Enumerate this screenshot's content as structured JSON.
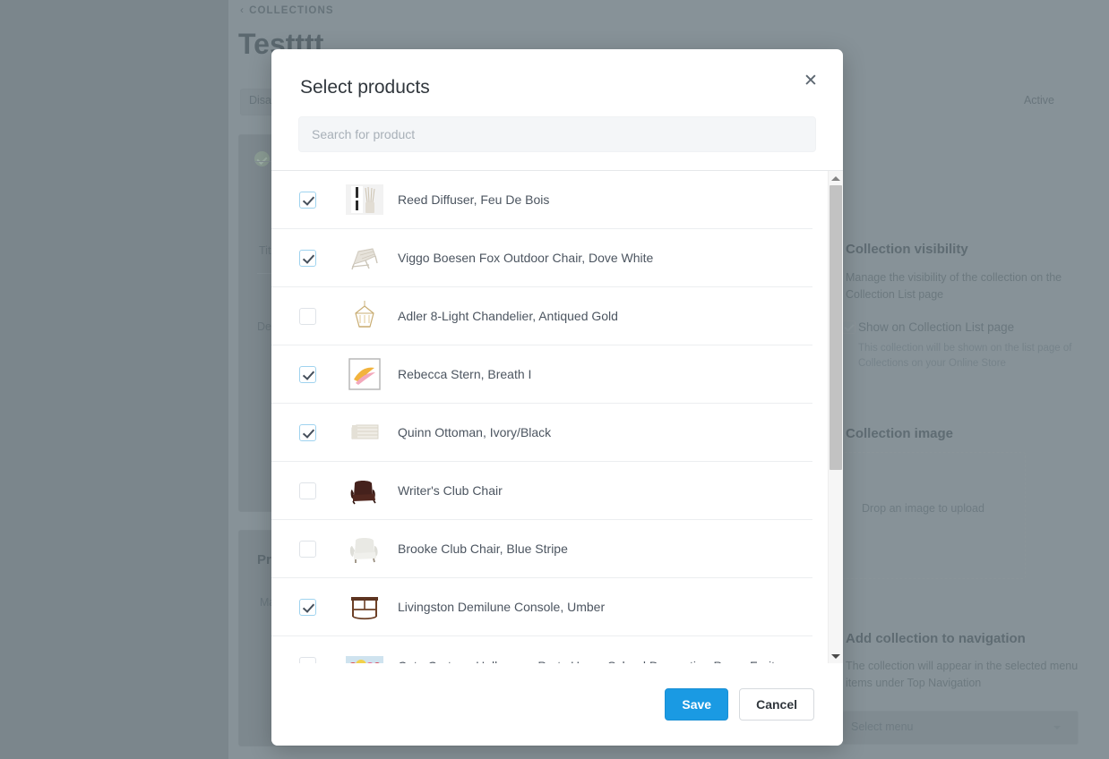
{
  "background": {
    "breadcrumb": "COLLECTIONS",
    "page_title": "Testttt",
    "status_pill": "Disable",
    "status_right": "Active",
    "field_title_label": "Title",
    "field_description_label": "Description",
    "products_section_title": "Products",
    "products_section_sub": "Manage",
    "rail": {
      "visibility_heading": "Collection visibility",
      "visibility_desc": "Manage the visibility of the collection on the Collection List page",
      "visibility_checkbox_label": "Show on Collection List page",
      "visibility_checkbox_sub": "This collection will be shown on the list page of Collections on your Online Store",
      "image_heading": "Collection image",
      "image_dropzone": "Drop an image to upload",
      "navigation_heading": "Add collection to navigation",
      "navigation_desc": "The collection will appear in the selected menu items under Top Navigation",
      "menu_select_value": "Select menu"
    }
  },
  "modal": {
    "title": "Select products",
    "close_icon": "close-icon",
    "search": {
      "placeholder": "Search for product",
      "value": ""
    },
    "products": [
      {
        "name": "Reed Diffuser, Feu De Bois",
        "checked": true,
        "thumb": "reed-diffuser"
      },
      {
        "name": "Viggo Boesen Fox Outdoor Chair, Dove White",
        "checked": true,
        "thumb": "outdoor-chair"
      },
      {
        "name": "Adler 8-Light Chandelier, Antiqued Gold",
        "checked": false,
        "thumb": "chandelier"
      },
      {
        "name": "Rebecca Stern, Breath I",
        "checked": true,
        "thumb": "artwork"
      },
      {
        "name": "Quinn Ottoman, Ivory/Black",
        "checked": true,
        "thumb": "ottoman"
      },
      {
        "name": "Writer's Club Chair",
        "checked": false,
        "thumb": "leather-chair"
      },
      {
        "name": "Brooke Club Chair, Blue Stripe",
        "checked": false,
        "thumb": "club-chair"
      },
      {
        "name": "Livingston Demilune Console, Umber",
        "checked": true,
        "thumb": "console-table"
      },
      {
        "name": "Cute Cartoon Halloween Party Home School Decoration Props Fruit",
        "checked": false,
        "thumb": "halloween-props"
      }
    ],
    "scrollbar": {
      "up_icon": "chevron-up-icon",
      "down_icon": "chevron-down-icon"
    },
    "footer": {
      "save_label": "Save",
      "cancel_label": "Cancel"
    }
  },
  "colors": {
    "accent": "#1a9ae3",
    "checkbox_border_checked": "#9fd3ef",
    "text_primary": "#31373d",
    "text_secondary": "#4c5560",
    "overlay": "#7b868c"
  }
}
